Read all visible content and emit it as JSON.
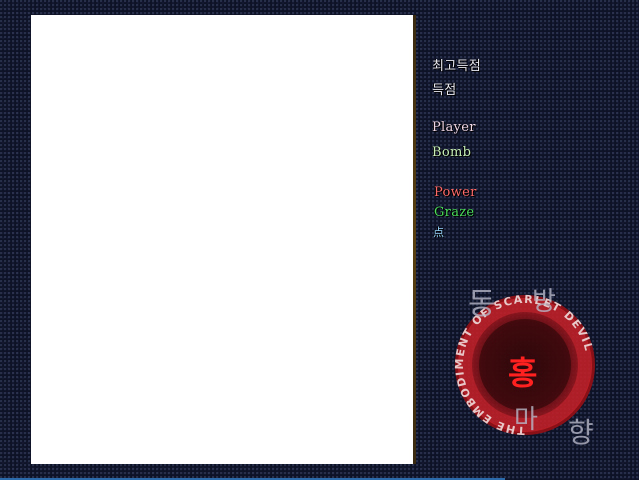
{
  "hud": {
    "hiscore_label": "최고득점",
    "score_label": "득점",
    "player_label": "Player",
    "bomb_label": "Bomb",
    "power_label": "Power",
    "graze_label": "Graze",
    "point_label": "点"
  },
  "logo": {
    "title_chars": [
      "동",
      "방",
      "홍",
      "마",
      "향"
    ],
    "ring_text": "THE EMBODIMENT OF SCARLET DEVIL"
  },
  "colors": {
    "background": "#0d1226",
    "playfield": "#ffffff",
    "power": "#ff6a6a",
    "graze": "#4adc5a",
    "point": "#9ad8ff",
    "logo_red": "#b01a22"
  }
}
